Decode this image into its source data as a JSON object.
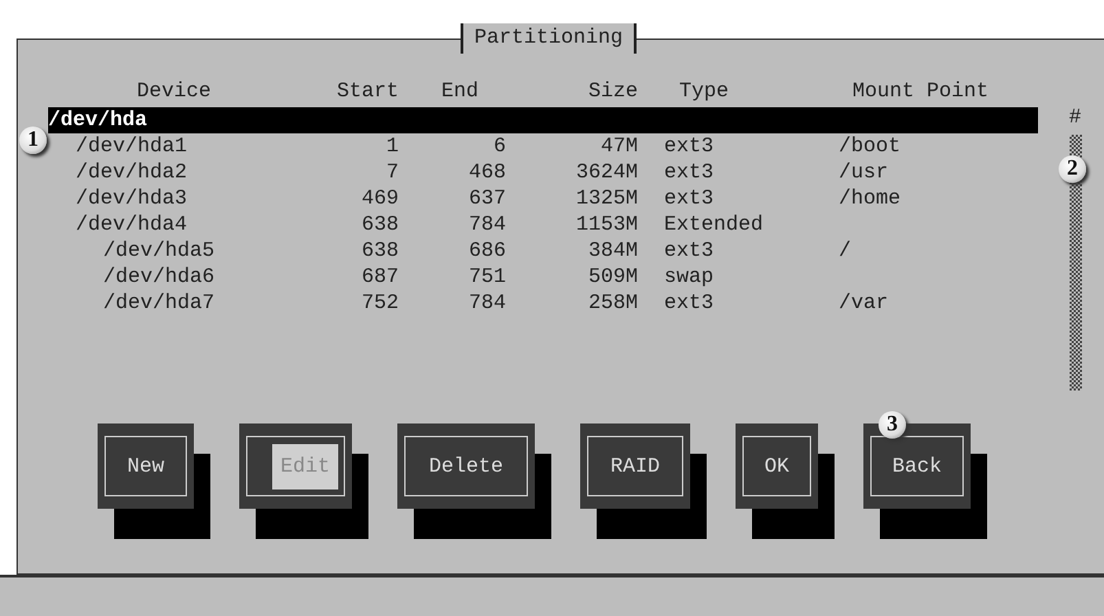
{
  "window": {
    "title": "Partitioning"
  },
  "table": {
    "columns": [
      "Device",
      "Start",
      "End",
      "Size",
      "Type",
      "Mount Point"
    ],
    "rows": [
      {
        "device": "/dev/hda",
        "selected": true,
        "children": [
          {
            "device": "/dev/hda1",
            "start": "1",
            "end": "6",
            "size": "47M",
            "type": "ext3",
            "mount": "/boot",
            "selected": false
          },
          {
            "device": "/dev/hda2",
            "start": "7",
            "end": "468",
            "size": "3624M",
            "type": "ext3",
            "mount": "/usr",
            "selected": false
          },
          {
            "device": "/dev/hda3",
            "start": "469",
            "end": "637",
            "size": "1325M",
            "type": "ext3",
            "mount": "/home",
            "selected": false
          },
          {
            "device": "/dev/hda4",
            "start": "638",
            "end": "784",
            "size": "1153M",
            "type": "Extended",
            "selected": false,
            "children": [
              {
                "device": "/dev/hda5",
                "start": "638",
                "end": "686",
                "size": "384M",
                "type": "ext3",
                "mount": "/",
                "selected": false
              },
              {
                "device": "/dev/hda6",
                "start": "687",
                "end": "751",
                "size": "509M",
                "type": "swap",
                "selected": false
              },
              {
                "device": "/dev/hda7",
                "start": "752",
                "end": "784",
                "size": "258M",
                "type": "ext3",
                "mount": "/var",
                "selected": false
              }
            ]
          }
        ]
      }
    ]
  },
  "scrollbar_mark": "#",
  "buttons": [
    {
      "label": "New",
      "focused": false
    },
    {
      "label": "Edit",
      "focused": true
    },
    {
      "label": "Delete",
      "focused": false
    },
    {
      "label": "RAID",
      "focused": false
    },
    {
      "label": "OK",
      "focused": false
    },
    {
      "label": "Back",
      "focused": false
    }
  ],
  "callouts": [
    "1",
    "2",
    "3"
  ]
}
